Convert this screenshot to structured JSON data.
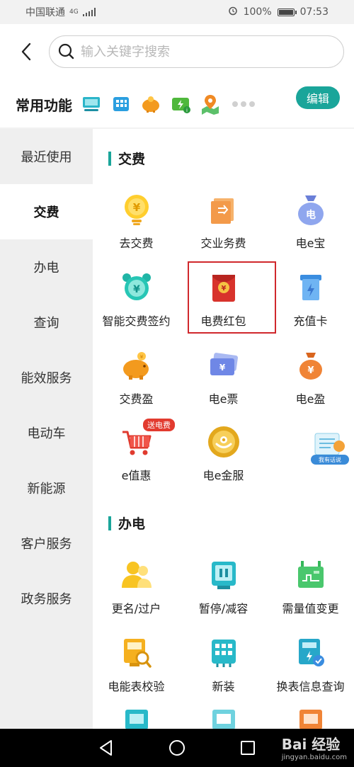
{
  "status_bar": {
    "carrier": "中国联通",
    "network": "4G",
    "battery": "100%",
    "time": "07:53"
  },
  "search": {
    "placeholder": "输入关键字搜索"
  },
  "common": {
    "title": "常用功能",
    "edit_label": "编辑",
    "quick_icons": [
      "monitor-icon",
      "building-icon",
      "piggy-bank-icon",
      "charger-icon",
      "map-pin-icon"
    ]
  },
  "sidebar": {
    "items": [
      {
        "label": "最近使用"
      },
      {
        "label": "交费"
      },
      {
        "label": "办电"
      },
      {
        "label": "查询"
      },
      {
        "label": "能效服务"
      },
      {
        "label": "电动车"
      },
      {
        "label": "新能源"
      },
      {
        "label": "客户服务"
      },
      {
        "label": "政务服务"
      }
    ],
    "active_index": 1
  },
  "sections": [
    {
      "title": "交费",
      "items": [
        {
          "label": "去交费",
          "icon": "bulb-yen-icon"
        },
        {
          "label": "交业务费",
          "icon": "receipt-icon"
        },
        {
          "label": "电e宝",
          "icon": "money-bag-icon"
        },
        {
          "label": "智能交费签约",
          "icon": "alarm-clock-icon"
        },
        {
          "label": "电费红包",
          "icon": "red-envelope-icon"
        },
        {
          "label": "充值卡",
          "icon": "recharge-card-icon"
        },
        {
          "label": "交费盈",
          "icon": "piggy-bank-icon"
        },
        {
          "label": "电e票",
          "icon": "ticket-icon"
        },
        {
          "label": "电e盈",
          "icon": "coin-bag-icon"
        },
        {
          "label": "e值惠",
          "icon": "shopping-cart-icon",
          "badge": "送电费"
        },
        {
          "label": "电e金服",
          "icon": "gold-coin-icon"
        }
      ]
    },
    {
      "title": "办电",
      "items": [
        {
          "label": "更名/过户",
          "icon": "users-icon"
        },
        {
          "label": "暂停/减容",
          "icon": "pause-meter-icon"
        },
        {
          "label": "需量值变更",
          "icon": "demand-icon"
        },
        {
          "label": "电能表校验",
          "icon": "meter-check-icon"
        },
        {
          "label": "新装",
          "icon": "new-install-icon"
        },
        {
          "label": "换表信息查询",
          "icon": "meter-query-icon"
        }
      ]
    }
  ],
  "float_widget": {
    "label": "我有话说"
  },
  "watermark": {
    "brand": "Bai 经验",
    "site": "jingyan.baidu.com"
  }
}
